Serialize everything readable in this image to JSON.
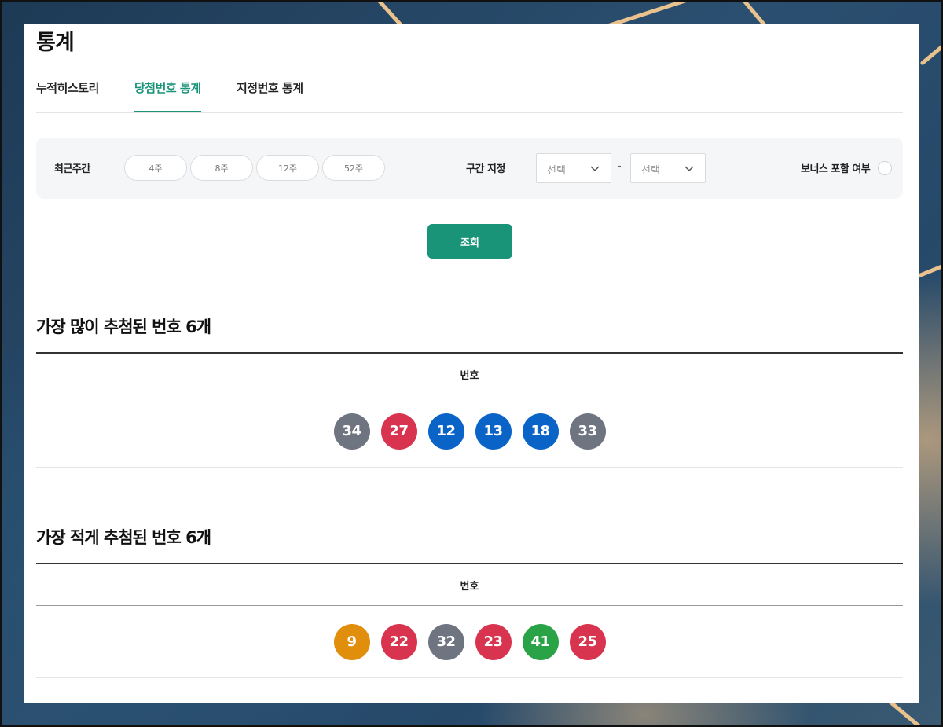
{
  "page": {
    "title": "통계"
  },
  "tabs": [
    {
      "label": "누적히스토리",
      "active": false
    },
    {
      "label": "당첨번호 통계",
      "active": true
    },
    {
      "label": "지정번호 통계",
      "active": false
    }
  ],
  "filter": {
    "recent_label": "최근주간",
    "periods": [
      "4주",
      "8주",
      "12주",
      "52주"
    ],
    "range_label": "구간 지정",
    "range_from": "선택",
    "range_to": "선택",
    "range_separator": "-",
    "bonus_label": "보너스 포함 여부",
    "bonus_checked": false
  },
  "search_button": "조회",
  "sections": [
    {
      "title": "가장 많이 추첨된 번호 6개",
      "column_header": "번호",
      "numbers": [
        {
          "value": "34",
          "color": "#6e7480"
        },
        {
          "value": "27",
          "color": "#d8344f"
        },
        {
          "value": "12",
          "color": "#0a64c8"
        },
        {
          "value": "13",
          "color": "#0a64c8"
        },
        {
          "value": "18",
          "color": "#0a64c8"
        },
        {
          "value": "33",
          "color": "#6e7480"
        }
      ]
    },
    {
      "title": "가장 적게 추첨된 번호 6개",
      "column_header": "번호",
      "numbers": [
        {
          "value": "9",
          "color": "#e08e0b"
        },
        {
          "value": "22",
          "color": "#d8344f"
        },
        {
          "value": "32",
          "color": "#6e7480"
        },
        {
          "value": "23",
          "color": "#d8344f"
        },
        {
          "value": "41",
          "color": "#2aa246"
        },
        {
          "value": "25",
          "color": "#d8344f"
        }
      ]
    }
  ],
  "colors": {
    "accent": "#1a9478"
  }
}
